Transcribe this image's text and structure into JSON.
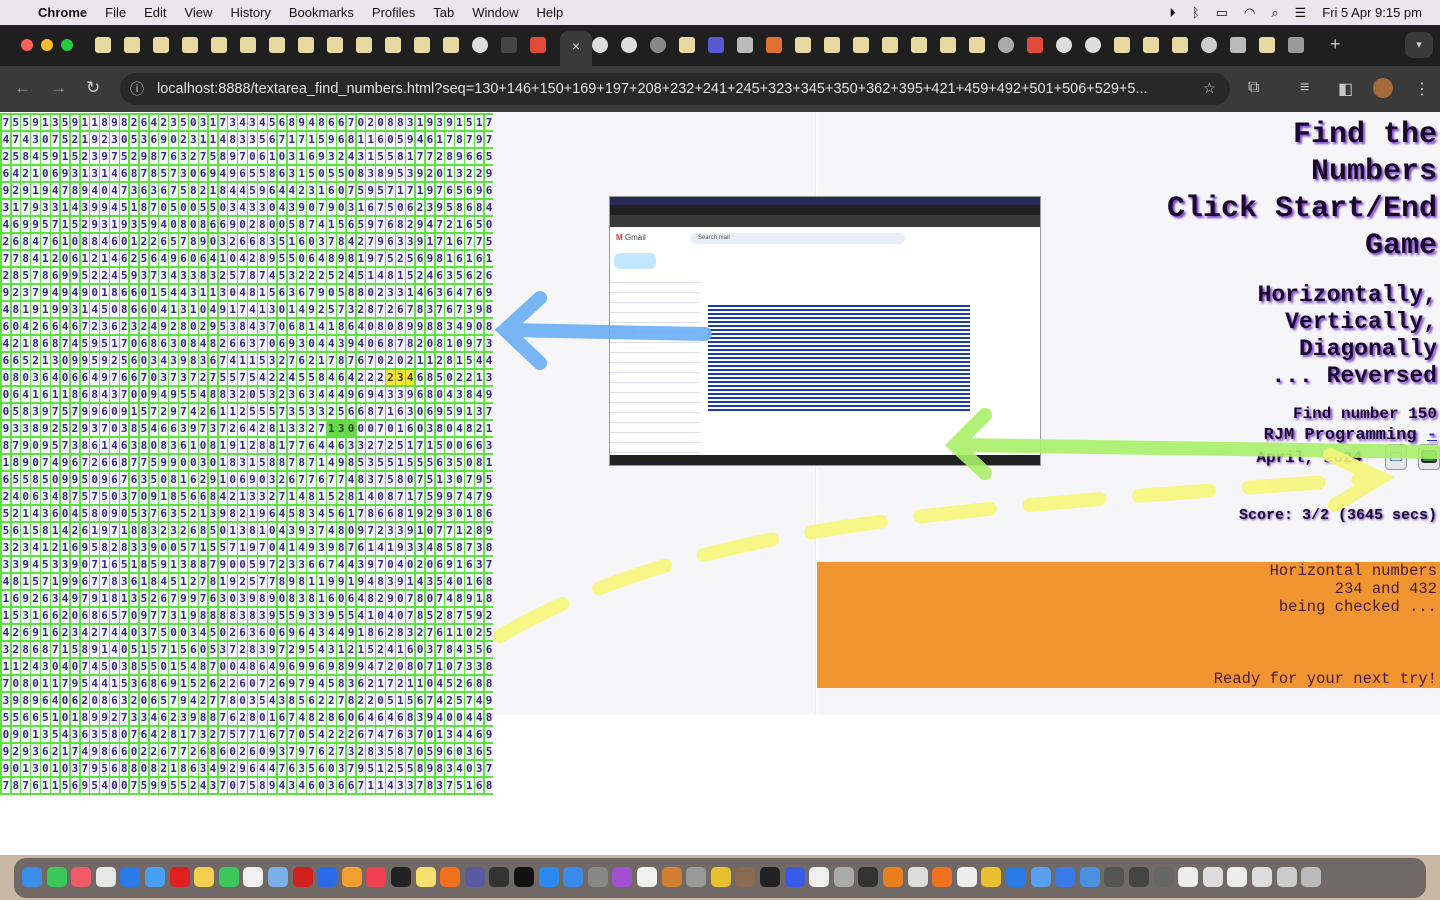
{
  "menubar": {
    "items": [
      "Chrome",
      "File",
      "Edit",
      "View",
      "History",
      "Bookmarks",
      "Profiles",
      "Tab",
      "Window",
      "Help"
    ],
    "clock": "Fri 5 Apr  9:15 pm",
    "status_icons": [
      "play-icon",
      "bluetooth-icon",
      "battery-icon",
      "wifi-icon",
      "search-icon",
      "control-center-icon"
    ]
  },
  "browser": {
    "url": "localhost:8888/textarea_find_numbers.html?seq=130+146+150+169+197+208+232+241+245+323+345+350+362+395+421+459+492+501+506+529+5...",
    "active_tab_close": "×",
    "new_tab": "+",
    "tab_favicons": [
      "page",
      "page",
      "page",
      "page",
      "page",
      "page",
      "page",
      "page",
      "page",
      "page",
      "page",
      "page",
      "page",
      "ghost",
      "infinity",
      "gmail",
      "active",
      "ghost",
      "ghost",
      "globe",
      "page",
      "badge",
      "speaker",
      "fire",
      "page",
      "page",
      "page",
      "page",
      "page",
      "page",
      "page",
      "compass",
      "gmail",
      "ghost",
      "ghost",
      "page",
      "page",
      "page",
      "chrome",
      "wordpress",
      "page",
      "history"
    ]
  },
  "grid": {
    "rows": [
      "75591359118982642350317343456894866702088319391517",
      "47430752192305369023114833567171596811605946178797",
      "25845915239752987632758970610316932431558177289665",
      "64210693131468785730694965586315055083895392013229 9",
      "92919478940473636758218445964423160759571719765696",
      "31793314399451870500550343304390790316750623958684",
      "46995715293193594080866902800587415659768294721650",
      "26847610884601226578903266835160378427963391716775",
      "77841206121462564960641042895506489819752569816161",
      "28578699522459373433832578745322252451481524635626",
      "92379494901866015443113048156367905880233146364769",
      "48191993145086604131049174130149257328726783767398",
      "60426646723623249280295384370681418640808998834908",
      "42186874595170686308482663706930443940687820810973",
      "66521309959256034398367411532762178767020211281544",
      "08036406649766703737275575422455846422223468502213",
      "06416118684370094955488320532363444969433968043849",
      "05839757996091572974261125557353325668716306959137",
      "93389252937038546639737264281332713000701603804821",
      "87909573861463808361081912881776446332725171500663",
      "18907496726687759900301831588787149853551555635081",
      "65585099509676350816291069032677677483758075130795",
      "24063487575037091856684213327148152814087175997479",
      "52143604580905376352139821964583456178668192930186",
      "56158142619718832326850138104393748097233910771289",
      "32341216958283390057155719704149398761419334858738",
      "33945339071651859138879005972336674439704020691637",
      "48157199677836184512781925778981199194839143540168",
      "16926349791813526799763039890838160648290780748918",
      "15316620686570977319888838395593395541040785287592",
      "42691623427440375003450263606964344918628327611025",
      "32868715891405157156053728397295431215241603784356",
      "11243040745038550154870048649699698994720807107338",
      "70801179544153686915262260726979458362172110452688",
      "39896406208632065794277803543856227822051567425749",
      "55665101899273346239887628016748286064646839400448",
      "09013543635807642817327577167705422267476370134469",
      "92936217498660226772686026093797627328358705960365",
      "90130103795688082186349296447635603795125589834037",
      "78761156954007599552437075894346036671143378375168"
    ],
    "highlights": [
      {
        "row": 16,
        "cols": [
          40,
          41,
          42
        ],
        "text": "234",
        "color": "#f2e93a"
      },
      {
        "row": 19,
        "cols": [
          34,
          35,
          36
        ],
        "text": "130",
        "color": "#6fd655"
      }
    ],
    "border_color": "#5ee03e",
    "digit_color": "#3b2484"
  },
  "panel": {
    "title_lines": [
      "Find the",
      "Numbers",
      "Click Start/End",
      "Game"
    ],
    "subtitle_lines": [
      "Horizontally,",
      "Vertically,",
      "Diagonally",
      "... Reversed"
    ],
    "find_number": "Find number 150",
    "author": "RJM Programming",
    "author_link": "-",
    "date": "April,  2024",
    "email_button_icon": "email-icon",
    "sms_button_icon": "sms-icon",
    "score": "Score: 3/2 (3645 secs)",
    "status_lines": [
      "Horizontal numbers",
      "234 and 432",
      "being checked ..."
    ],
    "ready": "Ready for your next try!",
    "status_bg": "#f0952f"
  },
  "embedded_screenshot": {
    "app": "Gmail",
    "search_placeholder": "Search mail"
  },
  "annotations": {
    "blue_arrow": "#6aaef5",
    "green_arrow": "#a9f06a",
    "yellow_dashed_arrow": "#f6f77a"
  },
  "dock": {
    "apps": [
      "finder",
      "messages",
      "music",
      "launchpad",
      "safari",
      "mail",
      "opera",
      "notes",
      "facetime",
      "textedit",
      "preview",
      "filezilla",
      "zoom",
      "photos",
      "news",
      "terminal",
      "notes2",
      "firefox",
      "games",
      "bbedit",
      "appletv",
      "appstore",
      "xcode",
      "sysprefs",
      "podcasts",
      "calendar",
      "books",
      "calculator",
      "chrome",
      "gimp",
      "terminal2",
      "quicktime",
      "files",
      "settings",
      "inkscape",
      "blender",
      "ghost",
      "firefox2",
      "pen",
      "chrome2",
      "maps",
      "folder",
      "network",
      "globe",
      "display",
      "display2",
      "window",
      "window2",
      "docs",
      "docs2",
      "docs3",
      "docs4",
      "trash"
    ]
  }
}
